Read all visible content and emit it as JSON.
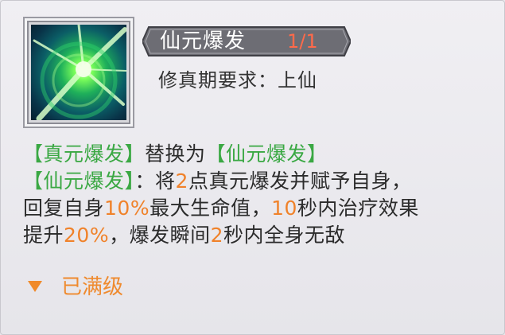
{
  "skill": {
    "name": "仙元爆发",
    "level": "1/1",
    "requirement": "修真期要求：上仙",
    "icon": "green-energy-burst-skill-icon"
  },
  "description": {
    "line1": {
      "a": "【真元爆发】",
      "b": "替换为",
      "c": "【仙元爆发】"
    },
    "line2": {
      "a": "【仙元爆发】",
      "b": "：将",
      "c": "2",
      "d": "点真元爆发并赋予自身，"
    },
    "line3": {
      "a": "回复自身",
      "b": "10%",
      "c": "最大生命值，",
      "d": "10",
      "e": "秒内治疗效果"
    },
    "line4": {
      "a": "提升",
      "b": "20%",
      "c": "，爆发瞬间",
      "d": "2",
      "e": "秒内全身无敌"
    }
  },
  "status": {
    "label": "已满级"
  },
  "colors": {
    "highlight_green": "#3aa843",
    "highlight_orange": "#f0822a",
    "level_red": "#ff6a4a"
  }
}
